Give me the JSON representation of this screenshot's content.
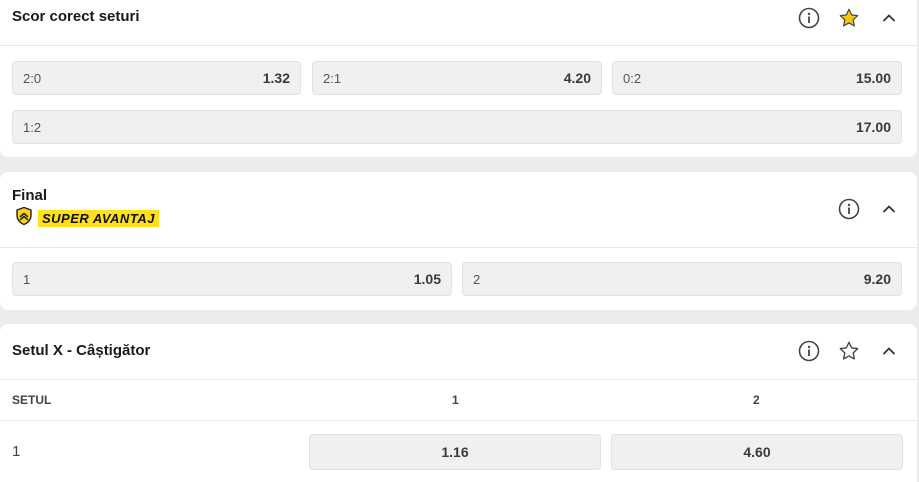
{
  "market1": {
    "title": "Scor corect seturi",
    "icons": {
      "info": "info-icon",
      "favorite": "star-filled-icon",
      "collapse": "chevron-up-icon"
    },
    "outcomes": [
      {
        "label": "2:0",
        "odd": "1.32"
      },
      {
        "label": "2:1",
        "odd": "4.20"
      },
      {
        "label": "0:2",
        "odd": "15.00"
      },
      {
        "label": "1:2",
        "odd": "17.00"
      }
    ]
  },
  "market2": {
    "title": "Final",
    "badge": "SUPER AVANTAJ",
    "icons": {
      "info": "info-icon",
      "collapse": "chevron-up-icon",
      "badge": "shield-chevron-icon"
    },
    "outcomes": [
      {
        "label": "1",
        "odd": "1.05"
      },
      {
        "label": "2",
        "odd": "9.20"
      }
    ]
  },
  "market3": {
    "title": "Setul X - Câștigător",
    "icons": {
      "info": "info-icon",
      "favorite": "star-outline-icon",
      "collapse": "chevron-up-icon"
    },
    "columns": {
      "set": "SETUL",
      "c1": "1",
      "c2": "2"
    },
    "rows": [
      {
        "set": "1",
        "odd1": "1.16",
        "odd2": "4.60"
      }
    ]
  },
  "colors": {
    "accent_star": "#f3c613",
    "badge_bg": "#ffe01a",
    "odd_bg": "#f0f0f0",
    "page_bg": "#ececed"
  }
}
